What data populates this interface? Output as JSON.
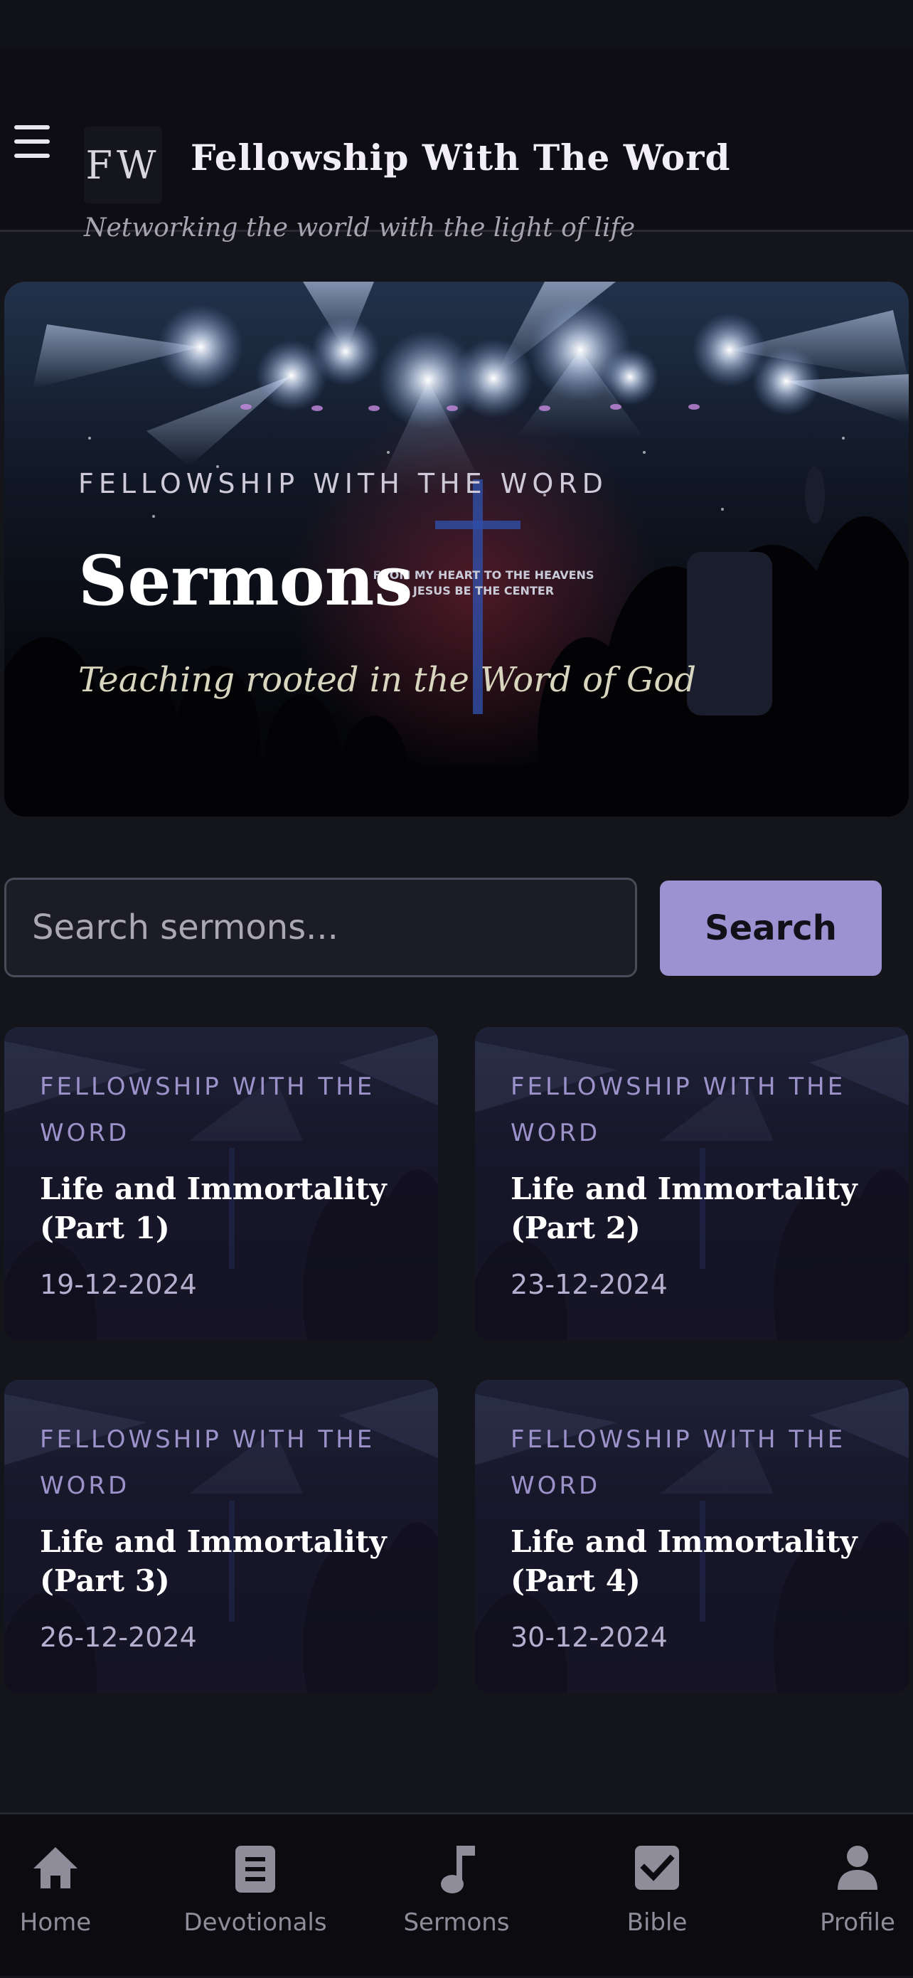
{
  "header": {
    "logo_text": "FW",
    "title": "Fellowship With The Word",
    "tagline": "Networking the world with the light of life"
  },
  "hero": {
    "eyebrow": "FELLOWSHIP WITH THE WORD",
    "title": "Sermons",
    "subtitle": "Teaching rooted in the Word of God",
    "stage_text_line1": "FROM MY HEART TO THE HEAVENS",
    "stage_text_line2": "JESUS BE THE CENTER"
  },
  "search": {
    "placeholder": "Search sermons...",
    "value": "",
    "button_label": "Search"
  },
  "sermons": [
    {
      "series": "FELLOWSHIP WITH THE WORD",
      "title": "Life and Immortality (Part 1)",
      "date": "19-12-2024"
    },
    {
      "series": "FELLOWSHIP WITH THE WORD",
      "title": "Life and Immortality (Part 2)",
      "date": "23-12-2024"
    },
    {
      "series": "FELLOWSHIP WITH THE WORD",
      "title": "Life and Immortality (Part 3)",
      "date": "26-12-2024"
    },
    {
      "series": "FELLOWSHIP WITH THE WORD",
      "title": "Life and Immortality (Part 4)",
      "date": "30-12-2024"
    }
  ],
  "tabbar": {
    "items": [
      {
        "label": "Home",
        "icon": "home-icon"
      },
      {
        "label": "Devotionals",
        "icon": "book-icon"
      },
      {
        "label": "Sermons",
        "icon": "music-note-icon"
      },
      {
        "label": "Bible",
        "icon": "checkbox-icon"
      },
      {
        "label": "Profile",
        "icon": "person-icon"
      }
    ]
  },
  "colors": {
    "accent": "#9c92d2",
    "background": "#14141b",
    "tab_inactive": "#8f8d99"
  }
}
